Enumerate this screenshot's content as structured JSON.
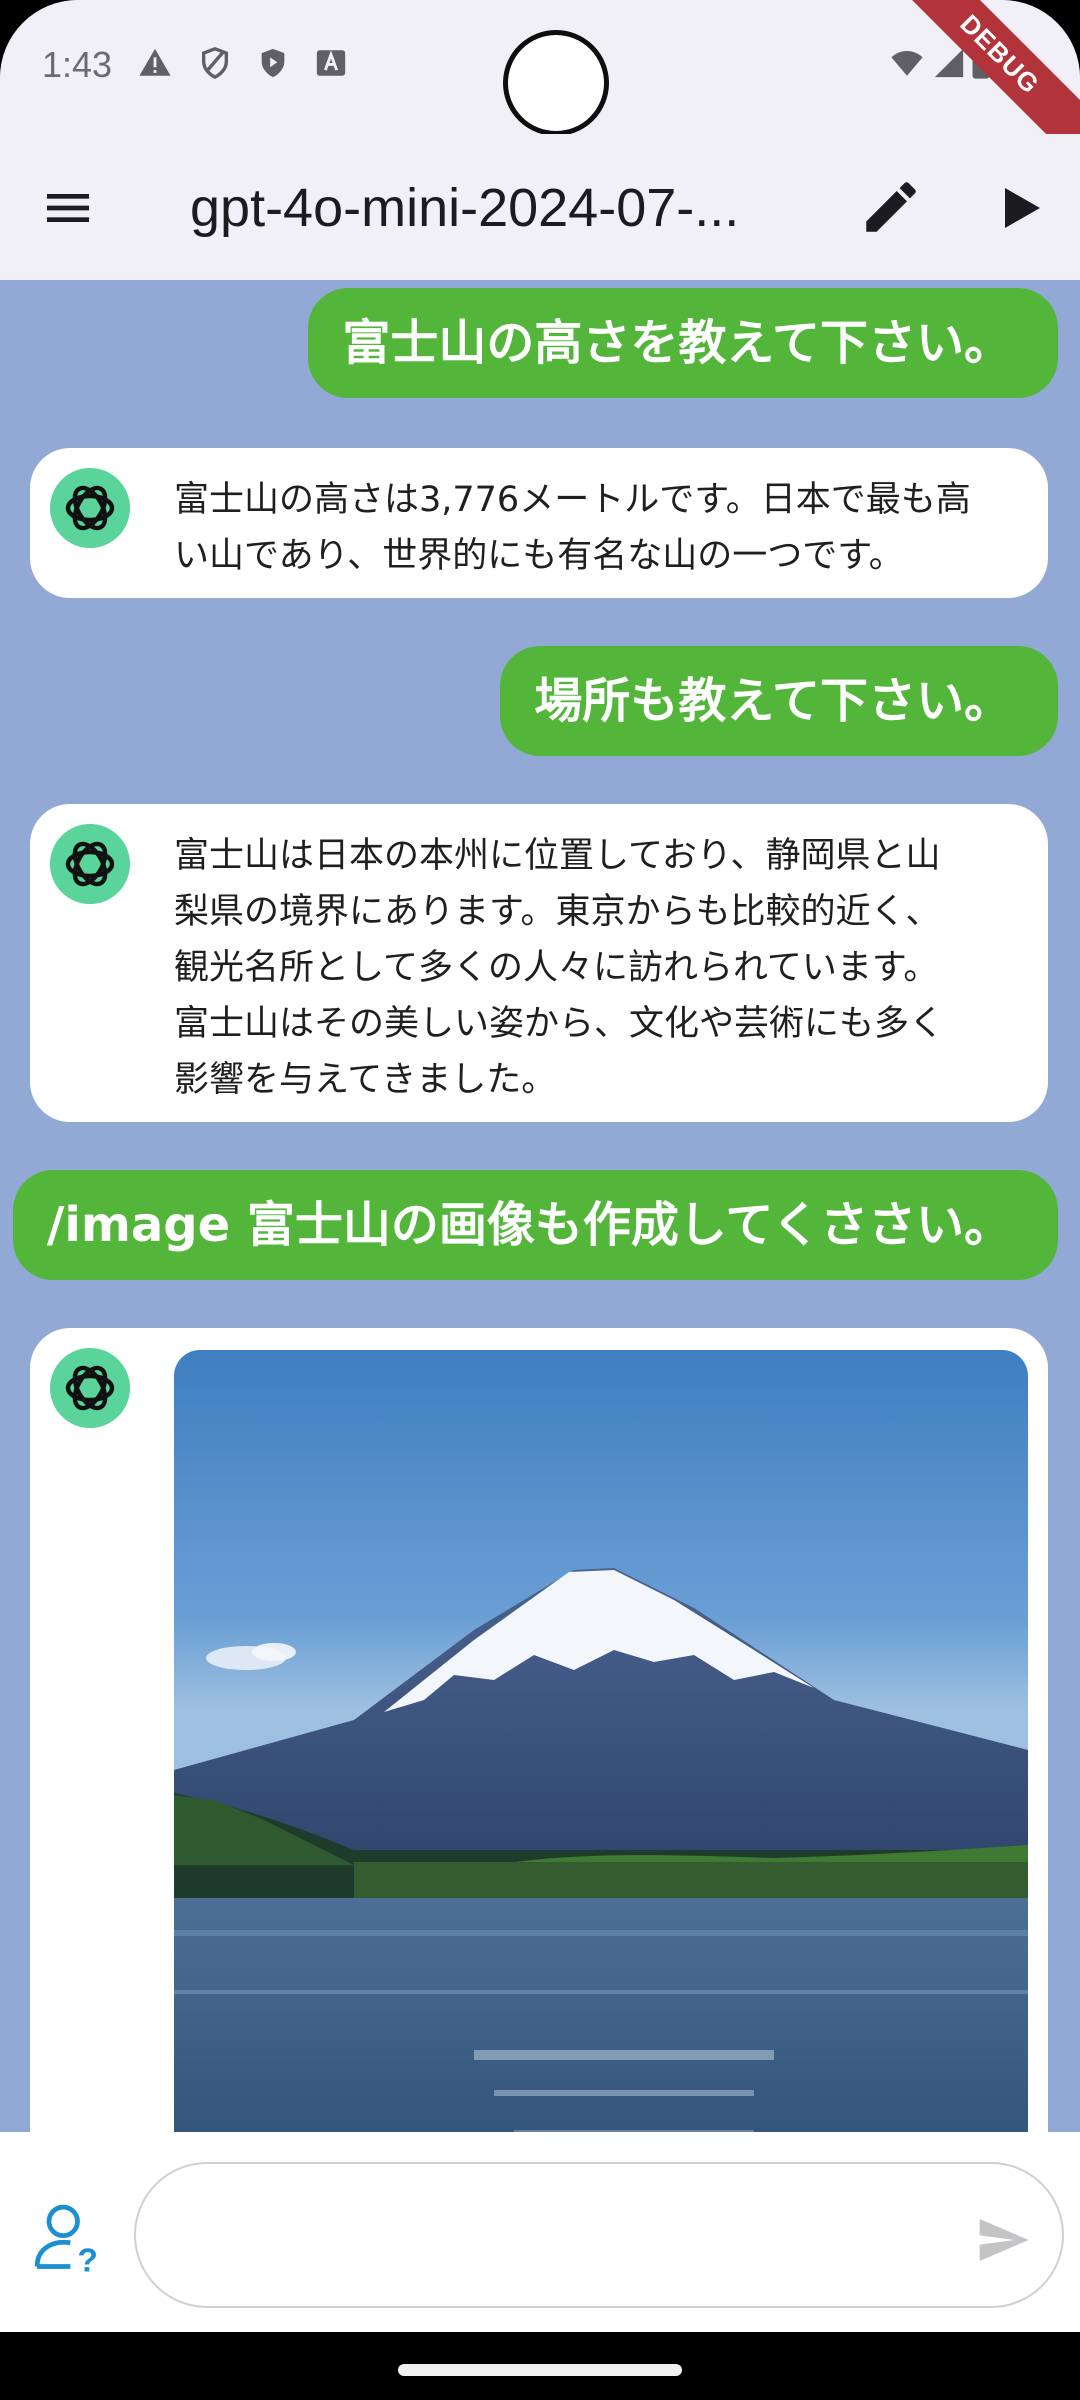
{
  "status_bar": {
    "time": "1:43",
    "icons": [
      "warning-icon",
      "shield-outline-icon",
      "play-shield-icon",
      "font-a-icon",
      "wifi-icon",
      "signal-icon",
      "battery-icon"
    ],
    "debug_label": "DEBUG"
  },
  "app_bar": {
    "title": "gpt-4o-mini-2024-07-...",
    "icons": [
      "menu-icon",
      "edit-icon",
      "run-icon"
    ]
  },
  "messages": [
    {
      "role": "user",
      "text": "富士山の高さを教えて下さい。"
    },
    {
      "role": "assistant",
      "lines": [
        "富士山の高さは3,776メートルです。日本で最も高",
        "い山であり、世界的にも有名な山の一つです。"
      ]
    },
    {
      "role": "user",
      "text": "場所も教えて下さい。"
    },
    {
      "role": "assistant",
      "lines": [
        "富士山は日本の本州に位置しており、静岡県と山",
        "梨県の境界にあります。東京からも比較的近く、",
        "観光名所として多くの人々に訪れられています。",
        "富士山はその美しい姿から、文化や芸術にも多く",
        "影響を与えてきました。"
      ]
    },
    {
      "role": "user",
      "text": "/image 富士山の画像も作成してくささい。"
    },
    {
      "role": "assistant",
      "content": "generated-image"
    }
  ],
  "input": {
    "value": "",
    "placeholder": ""
  },
  "colors": {
    "chat_background": "#91a9d4",
    "user_bubble": "#53b63b",
    "assistant_bubble": "#ffffff",
    "bar_background": "#f0f0f6",
    "accent": "#1a8fd1"
  }
}
